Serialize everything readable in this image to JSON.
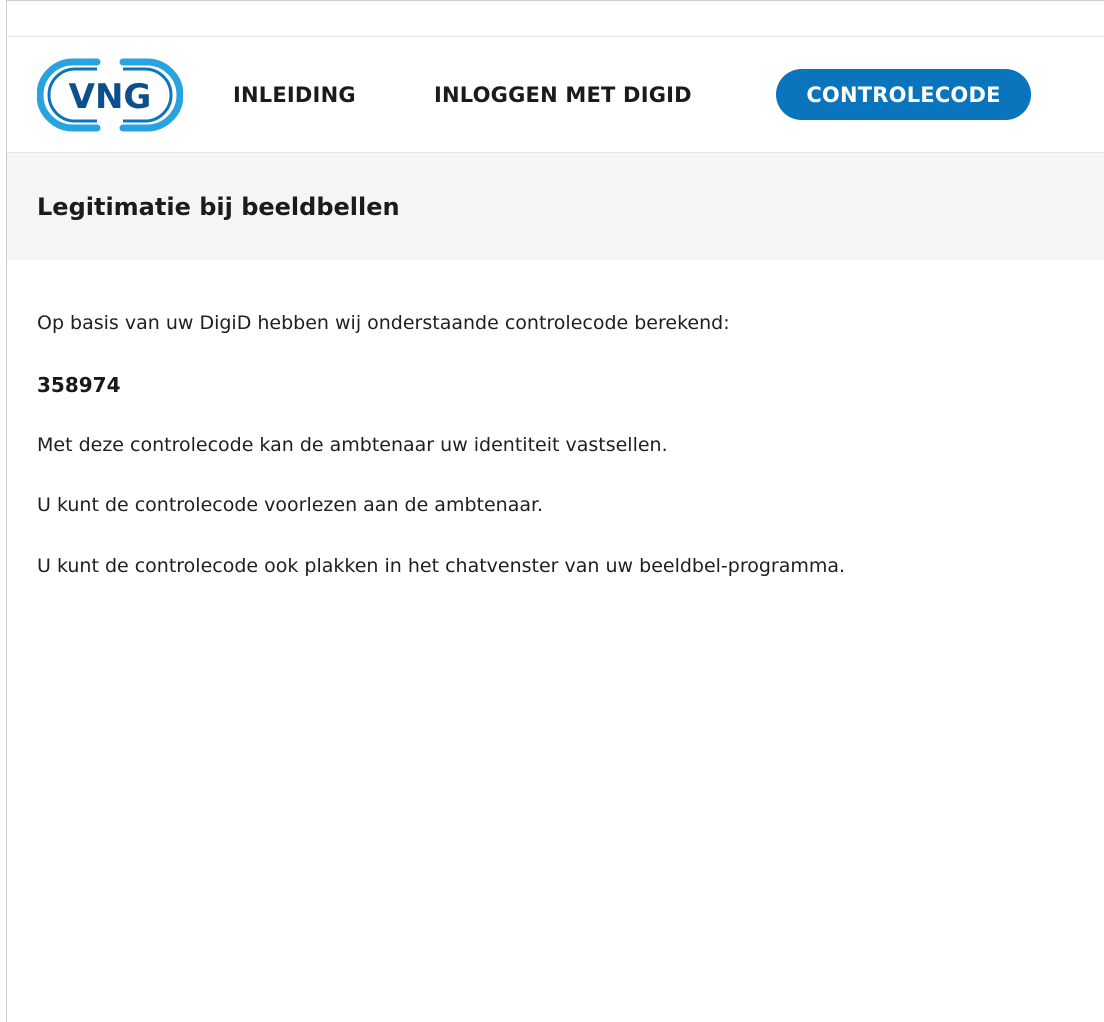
{
  "logo": {
    "text": "VNG",
    "color": "#0a75bc",
    "accent": "#29a3e0"
  },
  "nav": {
    "items": [
      {
        "label": "INLEIDING"
      },
      {
        "label": "INLOGGEN MET DIGID"
      },
      {
        "label": "CONTROLECODE",
        "active": true
      }
    ],
    "active_color": "#0a75bc"
  },
  "page": {
    "title": "Legitimatie bij beeldbellen"
  },
  "content": {
    "intro": "Op basis van uw DigiD hebben wij onderstaande controlecode berekend:",
    "code": "358974",
    "line1": "Met deze controlecode kan de ambtenaar uw identiteit vastsellen.",
    "line2": "U kunt de controlecode voorlezen aan de ambtenaar.",
    "line3": "U kunt de controlecode ook plakken in het chatvenster van uw  beeldbel-programma."
  }
}
